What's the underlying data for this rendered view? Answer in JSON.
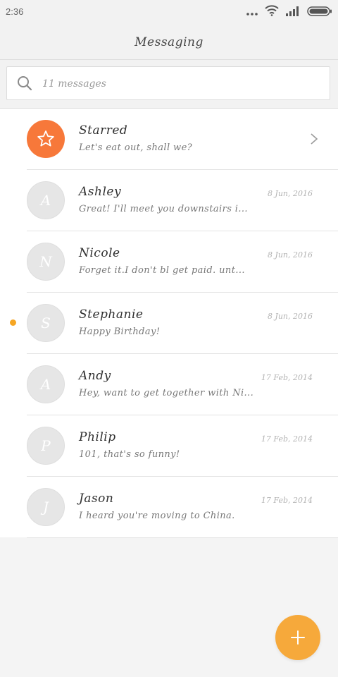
{
  "status_bar": {
    "time": "2:36",
    "icons": [
      "more-dots-icon",
      "wifi-icon",
      "signal-icon",
      "battery-icon"
    ]
  },
  "header": {
    "title": "Messaging"
  },
  "search": {
    "placeholder": "11 messages",
    "icon": "search-icon"
  },
  "conversations": [
    {
      "name": "Starred",
      "preview": "Let's eat out, shall we?",
      "date": "",
      "avatar": "star-icon",
      "avatar_color": "#f7783a",
      "unread": false
    },
    {
      "name": "Ashley",
      "preview": "Great! I'll meet you downstairs i...",
      "date": "8 Jun, 2016",
      "avatar": "A",
      "unread": false
    },
    {
      "name": "Nicole",
      "preview": "Forget it.I don't bl get paid. unt...",
      "date": "8 Jun, 2016",
      "avatar": "N",
      "unread": false
    },
    {
      "name": "Stephanie",
      "preview": "Happy Birthday!",
      "date": "8 Jun, 2016",
      "avatar": "S",
      "unread": true
    },
    {
      "name": "Andy",
      "preview": "Hey, want to get together with Ni...",
      "date": "17 Feb, 2014",
      "avatar": "A",
      "unread": false
    },
    {
      "name": "Philip",
      "preview": "101, that's so funny!",
      "date": "17 Feb, 2014",
      "avatar": "P",
      "unread": false
    },
    {
      "name": "Jason",
      "preview": "I heard you're moving to China.",
      "date": "17 Feb, 2014",
      "avatar": "J",
      "unread": false
    }
  ],
  "fab": {
    "icon": "plus-icon",
    "color": "#f6a93b"
  },
  "colors": {
    "accent_orange": "#f7783a",
    "unread_dot": "#f6a623",
    "background": "#f4f4f4"
  }
}
